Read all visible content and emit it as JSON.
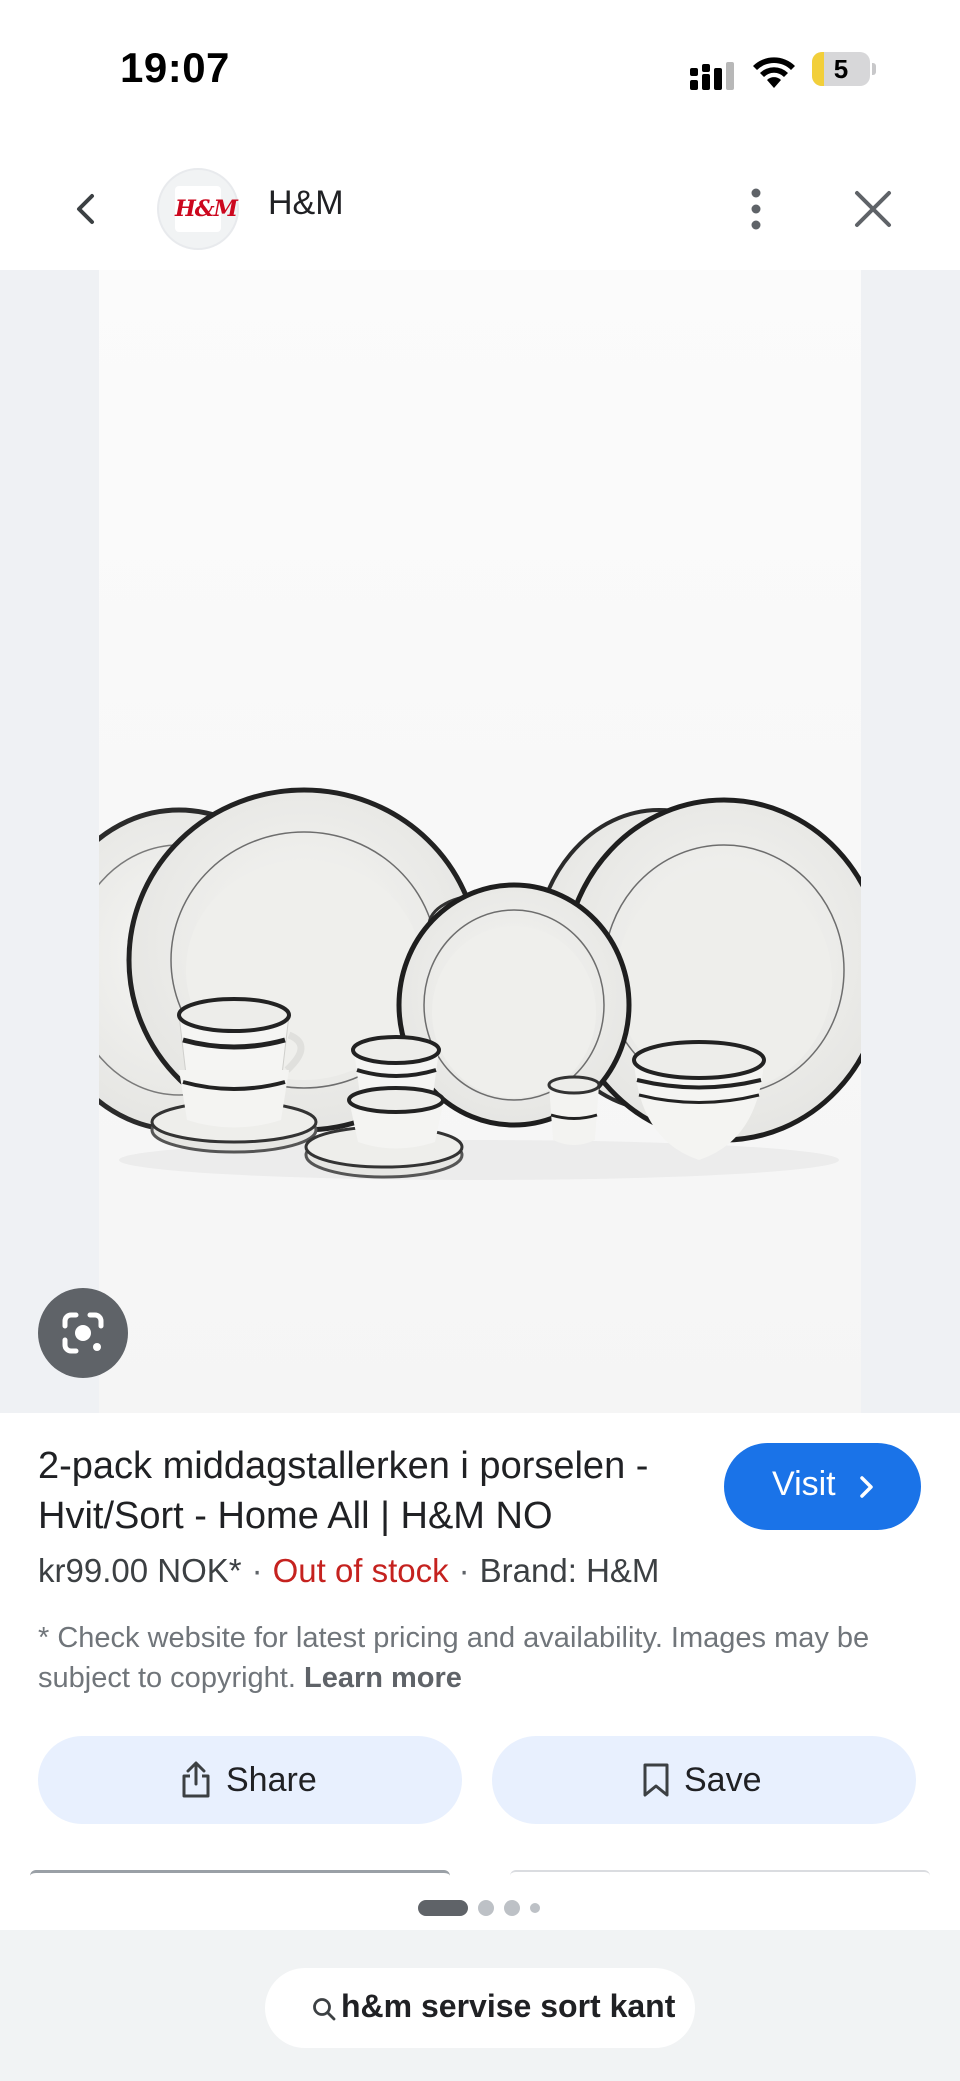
{
  "status_bar": {
    "time": "19:07",
    "battery": "5",
    "battery_level": 0.05
  },
  "header": {
    "logo_text": "H&M",
    "site_name": "H&M"
  },
  "product": {
    "title": "2-pack middagstallerken i porselen - Hvit/Sort - Home All | H&M NO",
    "visit_label": "Visit",
    "price": "kr99.00 NOK*",
    "stock": "Out of stock",
    "brand": "Brand: H&M",
    "disclaimer": "* Check website for latest pricing and availability. Images may be subject to copyright.",
    "learn_more": "Learn more",
    "stock_color": "#c5221f",
    "accent_color": "#1a73e8"
  },
  "actions": {
    "share_label": "Share",
    "save_label": "Save"
  },
  "pager": {
    "total": 4,
    "active": 0
  },
  "search": {
    "query": "h&m servise sort kant"
  },
  "icons": [
    "chevron-left-icon",
    "more-vert-icon",
    "close-icon",
    "lens-icon",
    "share-icon",
    "bookmark-icon",
    "chevron-right-icon",
    "search-icon",
    "signal-icon",
    "wifi-icon",
    "battery-icon"
  ]
}
